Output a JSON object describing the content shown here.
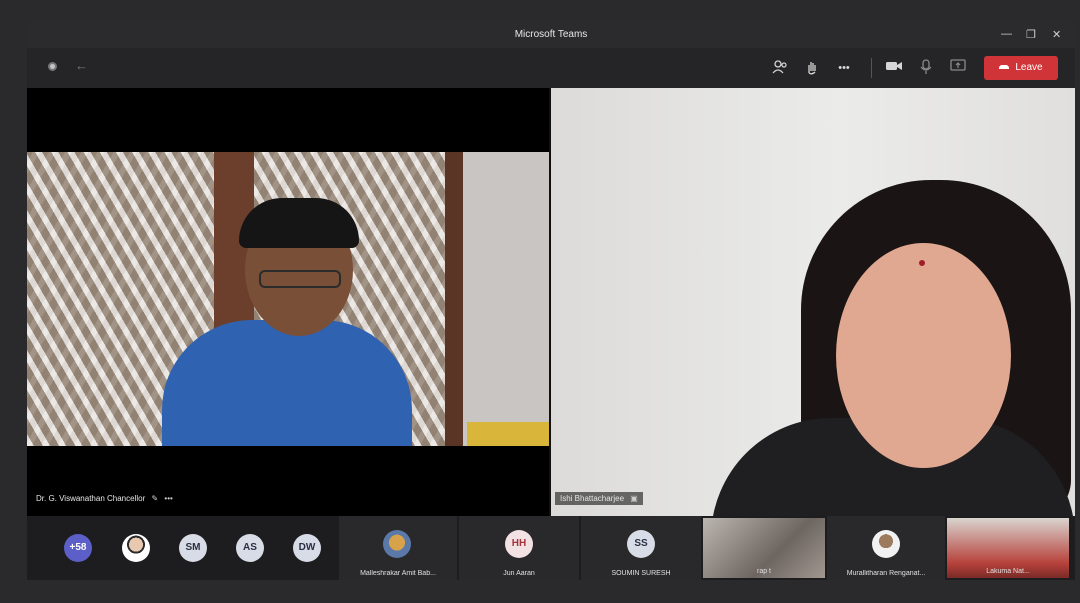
{
  "window": {
    "title": "Microsoft Teams",
    "controls": {
      "minimize": "—",
      "restore": "❐",
      "close": "✕"
    }
  },
  "toolbar": {
    "icons": [
      "participants-icon",
      "raise-hand-icon",
      "more-icon",
      "camera-icon",
      "mic-icon",
      "share-icon"
    ],
    "more_label": "•••",
    "leave_label": "Leave"
  },
  "participants_main": [
    {
      "name": "Dr. G. Viswanathan Chancellor",
      "extra": "•••"
    },
    {
      "name": "Ishi Bhattacharjee"
    }
  ],
  "strip": {
    "overflow_count": "+58",
    "avatars": [
      {
        "initials": "SM"
      },
      {
        "initials": "AS"
      },
      {
        "initials": "DW"
      }
    ],
    "tiles": [
      {
        "label": "Malleshrakar Amit Bab..."
      },
      {
        "initials": "HH",
        "label": "Jun Aaran",
        "extra": "•••"
      },
      {
        "initials": "SS",
        "label": "SOUMIN SURESH"
      },
      {
        "label": "rap t"
      },
      {
        "label": "Murallitharan Renganat..."
      },
      {
        "label": "Lakuma Nat..."
      }
    ]
  },
  "colors": {
    "leave": "#d13438",
    "accent": "#5b5fc7",
    "background": "#1e1e20"
  }
}
